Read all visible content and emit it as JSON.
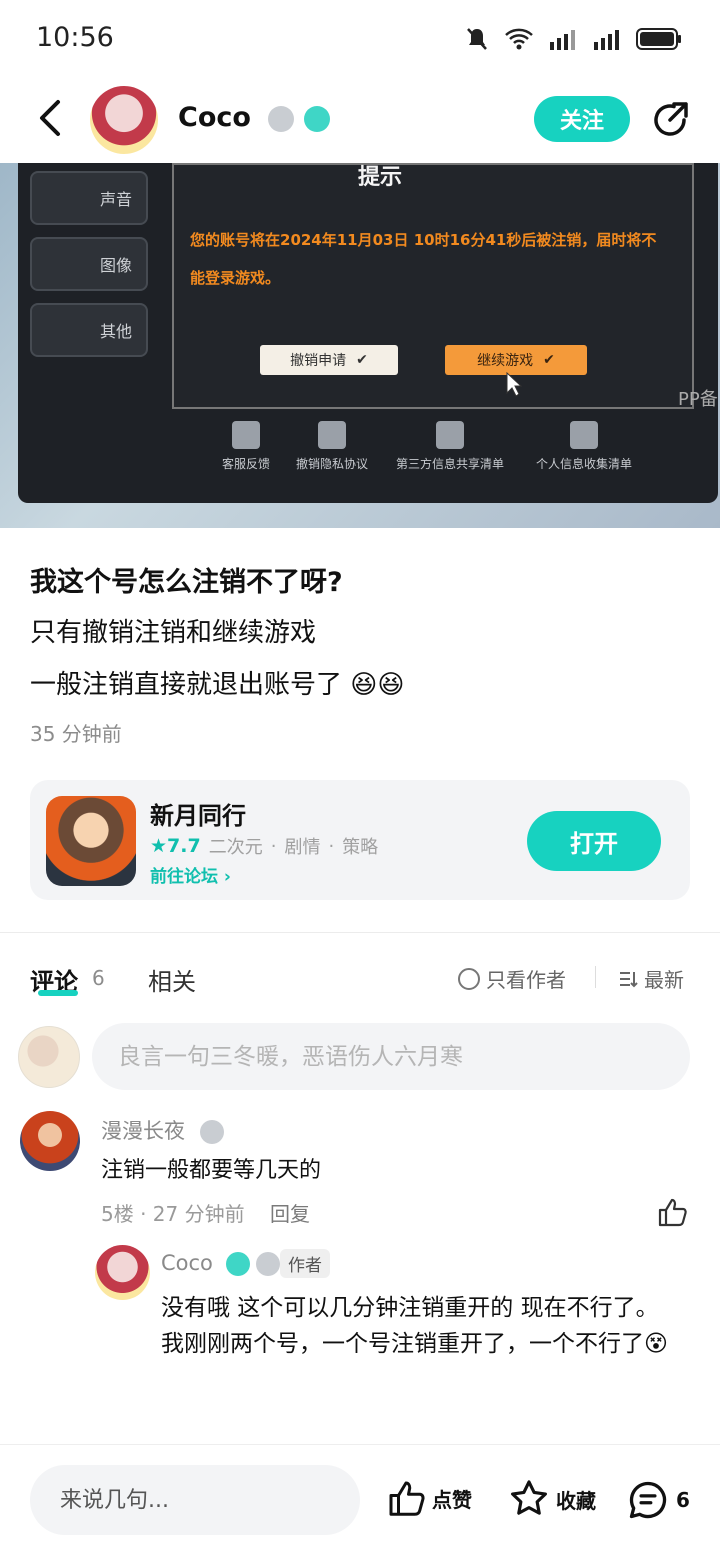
{
  "status": {
    "time": "10:56",
    "icons": [
      "bluetooth-icon",
      "battery-saver-icon",
      "mute-icon",
      "wifi-icon",
      "signal-icon",
      "signal-icon",
      "battery-icon"
    ]
  },
  "header": {
    "author_name": "Coco",
    "follow_label": "关注"
  },
  "post_image": {
    "dialog_title": "提示",
    "dialog_message": "您的账号将在2024年11月03日 10时16分41秒后被注销，届时将不能登录游戏。",
    "cancel_button": "撤销申请",
    "continue_button": "继续游戏",
    "side_menu": [
      "声音",
      "图像",
      "其他"
    ],
    "bottom_items": [
      "客服反馈",
      "撤销隐私协议",
      "第三方信息共享清单",
      "个人信息收集清单"
    ],
    "corner_text": "PP备"
  },
  "post": {
    "title": "我这个号怎么注销不了呀?",
    "line1": "只有撤销注销和继续游戏",
    "line2": "一般注销直接就退出账号了",
    "time": "35 分钟前"
  },
  "game_card": {
    "name": "新月同行",
    "rating": "7.7",
    "tags": [
      "二次元",
      "剧情",
      "策略"
    ],
    "forum_link": "前往论坛",
    "open_label": "打开"
  },
  "comments_header": {
    "comments_tab": "评论",
    "comments_count": "6",
    "related_tab": "相关",
    "only_author": "只看作者",
    "sort_label": "最新"
  },
  "comment_input": {
    "placeholder": "良言一句三冬暖，恶语伤人六月寒"
  },
  "comments": [
    {
      "user": "漫漫长夜",
      "text": "注销一般都要等几天的",
      "meta": "5楼 · 27 分钟前",
      "reply_label": "回复"
    }
  ],
  "reply": {
    "user": "Coco",
    "author_tag": "作者",
    "line1": "没有哦 这个可以几分钟注销重开的 现在不行了。",
    "line2": "我刚刚两个号，一个号注销重开了，一个不行了"
  },
  "bottom_bar": {
    "input_placeholder": "来说几句...",
    "like_label": "点赞",
    "collect_label": "收藏",
    "comment_count": "6"
  },
  "colors": {
    "accent": "#17d2c0",
    "dialog_text": "#f28a1f"
  }
}
